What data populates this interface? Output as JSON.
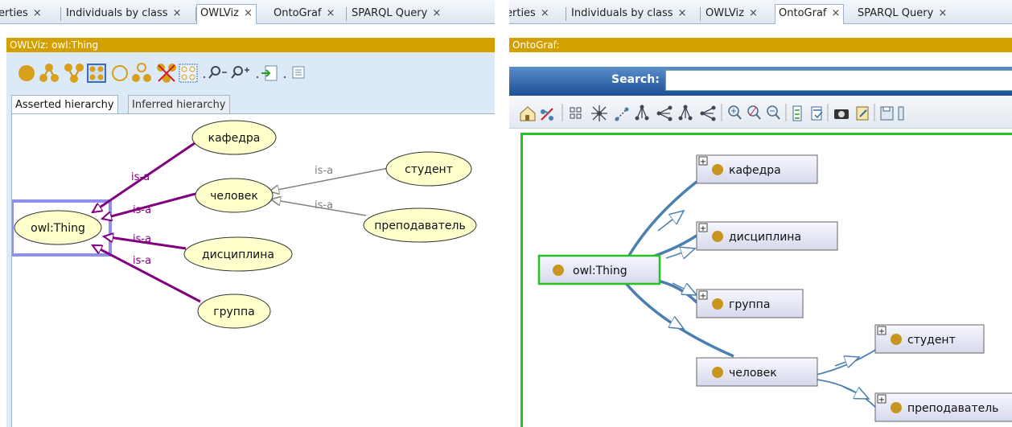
{
  "left": {
    "tabs": [
      {
        "label": "erties",
        "close": "×"
      },
      {
        "label": "Individuals by class",
        "close": "×"
      },
      {
        "label": "OWLViz",
        "close": "×",
        "selected": true
      },
      {
        "label": "OntoGraf",
        "close": "×"
      },
      {
        "label": "SPARQL Query",
        "close": "×"
      }
    ],
    "title": "OWLViz: owl:Thing",
    "subtabs": [
      "Asserted hierarchy",
      "Inferred hierarchy"
    ],
    "toolbar_icons": [
      "show-class-icon",
      "show-subclasses-icon",
      "show-superclasses-icon",
      "show-all-icon",
      "hide-class-icon",
      "hide-subclasses-icon",
      "hide-superclasses-icon",
      "hide-all-icon",
      "zoom-out-icon",
      "zoom-in-icon",
      "export-icon",
      "options-icon"
    ],
    "graph": {
      "nodes": {
        "thing": "owl:Thing",
        "kafedra": "кафедра",
        "chelovek": "человек",
        "disciplina": "дисциплина",
        "gruppa": "группа",
        "student": "студент",
        "prepodavatel": "преподаватель"
      },
      "edge_label": "is-a",
      "colors": {
        "node_fill": "#ffffcc",
        "primary_edge": "#800080",
        "secondary_edge": "#808080",
        "selection": "#8f8fef"
      }
    }
  },
  "right": {
    "tabs": [
      {
        "label": "erties",
        "close": "×"
      },
      {
        "label": "Individuals by class",
        "close": "×"
      },
      {
        "label": "OWLViz",
        "close": "×"
      },
      {
        "label": "OntoGraf",
        "close": "×",
        "selected": true
      },
      {
        "label": "SPARQL Query",
        "close": "×"
      }
    ],
    "title": "OntoGraf:",
    "search_label": "Search:",
    "search_value": "",
    "toolbar_icons": [
      "home-icon",
      "reset-icon",
      "grid-layout-icon",
      "radial-layout-icon",
      "spring-layout-icon",
      "tree-vertical-icon",
      "tree-horizontal-icon",
      "tree-vertical-alt-icon",
      "tree-horizontal-alt-icon",
      "zoom-in-icon",
      "zoom-reset-icon",
      "zoom-out-icon",
      "filter-icon",
      "arcs-icon",
      "camera-icon",
      "notes-icon",
      "save-icon"
    ],
    "graph": {
      "nodes": {
        "thing": "owl:Thing",
        "kafedra": "кафедра",
        "disciplina": "дисциплина",
        "gruppa": "группа",
        "chelovek": "человек",
        "student": "студент",
        "prepodavatel": "преподаватель"
      },
      "expand_glyph": "+",
      "colors": {
        "dot": "#c8961e",
        "edge": "#4a7fb0",
        "selected_border": "#26c226",
        "canvas_border": "#26c226"
      }
    }
  }
}
